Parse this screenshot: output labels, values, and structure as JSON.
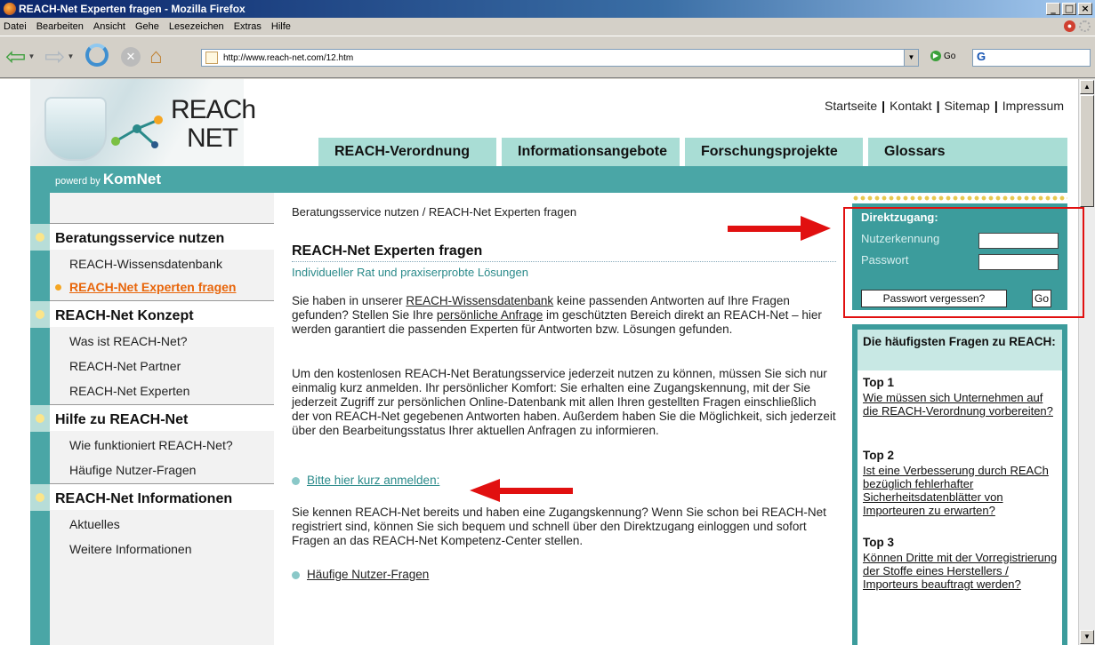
{
  "window": {
    "title": "REACH-Net Experten fragen - Mozilla Firefox"
  },
  "menu": [
    "Datei",
    "Bearbeiten",
    "Ansicht",
    "Gehe",
    "Lesezeichen",
    "Extras",
    "Hilfe"
  ],
  "nav": {
    "url": "http://www.reach-net.com/12.htm",
    "go_label": "Go",
    "search_value": "G"
  },
  "site": {
    "logo_line1": "REACh",
    "logo_line2": "NET",
    "toplinks": [
      "Startseite",
      "Kontakt",
      "Sitemap",
      "Impressum"
    ],
    "tabs": [
      "REACH-Verordnung",
      "Informationsangebote",
      "Forschungsprojekte",
      "Glossars"
    ],
    "powered_prefix": "powerd by",
    "powered_brand": "KomNet"
  },
  "sidebar": {
    "sections": [
      {
        "title": "Beratungsservice nutzen",
        "items": [
          "REACH-Wissensdatenbank",
          "REACH-Net Experten fragen"
        ]
      },
      {
        "title": "REACH-Net Konzept",
        "items": [
          "Was ist REACH-Net?",
          "REACH-Net Partner",
          "REACH-Net Experten"
        ]
      },
      {
        "title": "Hilfe zu REACH-Net",
        "items": [
          "Wie funktioniert REACH-Net?",
          "Häufige Nutzer-Fragen"
        ]
      },
      {
        "title": "REACH-Net Informationen",
        "items": [
          "Aktuelles",
          "Weitere Informationen"
        ]
      }
    ],
    "active_item": "REACH-Net Experten fragen"
  },
  "main": {
    "breadcrumb": "Beratungsservice nutzen / REACH-Net Experten fragen",
    "heading": "REACH-Net Experten fragen",
    "subheading": "Individueller Rat und praxiserprobte Lösungen",
    "p1_a": "Sie haben in unserer ",
    "p1_link1": "REACH-Wissensdatenbank",
    "p1_b": " keine passenden Antworten auf Ihre Fragen gefunden? Stellen Sie Ihre ",
    "p1_link2": "persönliche Anfrage",
    "p1_c": " im geschützten Bereich direkt an REACH-Net – hier werden garantiert die passenden Experten für Antworten bzw. Lösungen gefunden.",
    "p2": "Um den kostenlosen REACH-Net Beratungsservice jederzeit nutzen zu können, müssen Sie sich nur einmalig kurz anmelden. Ihr persönlicher Komfort: Sie erhalten eine Zugangskennung, mit der Sie jederzeit Zugriff zur persönlichen Online-Datenbank mit allen Ihren gestellten Fragen einschließlich der von REACH-Net gegebenen Antworten haben. Außerdem haben Sie die Möglichkeit, sich jederzeit über den Bearbeitungsstatus Ihrer aktuellen Anfragen zu informieren.",
    "register_link": "Bitte hier kurz anmelden:",
    "p3": "Sie kennen REACH-Net bereits und haben eine Zugangskennung? Wenn Sie schon bei REACH-Net registriert sind, können Sie sich bequem und schnell über den Direktzugang einloggen und sofort Fragen an das REACH-Net Kompetenz-Center stellen.",
    "faq_link": "Häufige Nutzer-Fragen"
  },
  "login": {
    "title": "Direktzugang:",
    "user_label": "Nutzerkennung",
    "password_label": "Passwort",
    "user_value": "",
    "password_value": "",
    "forgot_label": "Passwort vergessen?",
    "go_label": "Go"
  },
  "faq": {
    "title": "Die häufigsten Fragen zu REACH:",
    "items": [
      {
        "top": "Top 1",
        "question": "Wie müssen sich Unternehmen auf die REACH-Verordnung vorbereiten?"
      },
      {
        "top": "Top 2",
        "question": "Ist eine Verbesserung durch REACh bezüglich fehlerhafter Sicherheitsdatenblätter von Importeuren zu erwarten?"
      },
      {
        "top": "Top 3",
        "question": "Können Dritte mit der Vorregistrierung der Stoffe eines Herstellers / Importeurs beauftragt werden?"
      }
    ]
  },
  "colors": {
    "teal": "#4aa6a6",
    "teal_dark": "#3c9c9c",
    "tab": "#a9ddd5",
    "highlight_red": "#e11010",
    "active_orange": "#e8650a"
  }
}
